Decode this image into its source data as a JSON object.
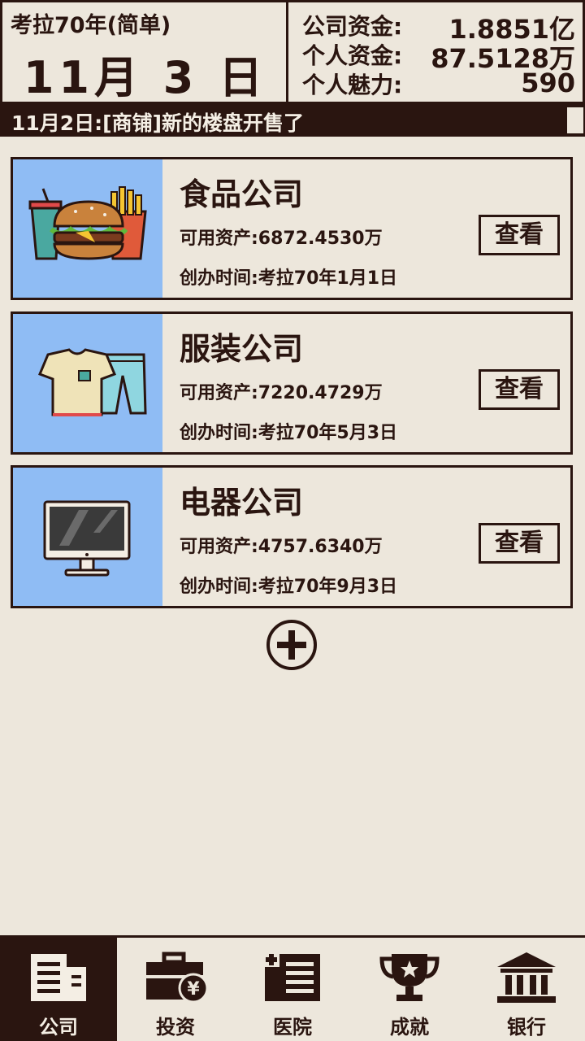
{
  "header": {
    "era": "考拉70年(简单)",
    "date": "11月 3 日",
    "stats": [
      {
        "label": "公司资金:",
        "value": "1.8851亿"
      },
      {
        "label": "个人资金:",
        "value": "87.5128万"
      },
      {
        "label": "个人魅力:",
        "value": "590"
      }
    ]
  },
  "ticker": {
    "text": "11月2日:[商铺]新的楼盘开售了"
  },
  "companies": [
    {
      "name": "食品公司",
      "assets": "可用资产:6872.4530万",
      "founded": "创办时间:考拉70年1月1日",
      "button": "查看",
      "icon": "burger-fries-icon"
    },
    {
      "name": "服装公司",
      "assets": "可用资产:7220.4729万",
      "founded": "创办时间:考拉70年5月3日",
      "button": "查看",
      "icon": "tshirt-jeans-icon"
    },
    {
      "name": "电器公司",
      "assets": "可用资产:4757.6340万",
      "founded": "创办时间:考拉70年9月3日",
      "button": "查看",
      "icon": "monitor-icon"
    }
  ],
  "nav": [
    {
      "label": "公司",
      "icon": "company-building-icon",
      "active": true
    },
    {
      "label": "投资",
      "icon": "briefcase-yen-icon",
      "active": false
    },
    {
      "label": "医院",
      "icon": "hospital-icon",
      "active": false
    },
    {
      "label": "成就",
      "icon": "trophy-icon",
      "active": false
    },
    {
      "label": "银行",
      "icon": "bank-icon",
      "active": false
    }
  ],
  "colors": {
    "dark": "#2a1510",
    "background": "#ede7dc",
    "thumb": "#8fbcf4"
  }
}
